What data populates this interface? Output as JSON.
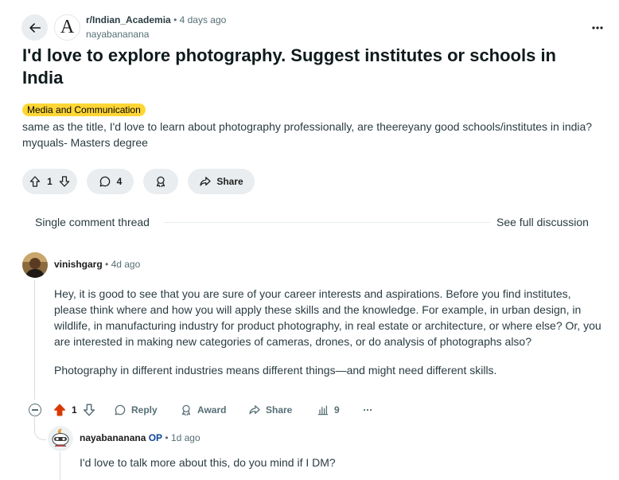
{
  "post": {
    "subreddit": "r/Indian_Academia",
    "subreddit_icon_letter": "A",
    "separator": "•",
    "time": "4 days ago",
    "author": "nayabananana",
    "title": "I'd love to explore photography. Suggest institutes or schools in India",
    "flair": "Media and Communication",
    "flair_color": "#ffd635",
    "body": "same as the title, I'd love to learn about photography professionally, are theereyany good schools/institutes in india? myquals- Masters degree",
    "votes": "1",
    "comments": "4",
    "share_label": "Share"
  },
  "thread": {
    "label": "Single comment thread",
    "full_link": "See full discussion"
  },
  "comment1": {
    "author": "vinishgarg",
    "separator": "•",
    "time": "4d ago",
    "paragraphs": [
      "Hey, it is good to see that you are sure of your career interests and aspirations. Before you find institutes, please think where and how you will apply these skills and the knowledge. For example, in urban design, in wildlife, in manufacturing industry for product photography, in real estate or architecture, or where else? Or, you are interested in making new categories of cameras, drones, or do analysis of photographs also?",
      "Photography in different industries means different things—and might need different skills."
    ],
    "votes": "1",
    "reply_label": "Reply",
    "award_label": "Award",
    "share_label": "Share",
    "insights": "9",
    "upvote_color": "#d93900"
  },
  "comment2": {
    "author": "nayabananana",
    "op_badge": "OP",
    "separator": "•",
    "time": "1d ago",
    "body": "I'd love to talk more about this, do you mind if I DM?"
  },
  "icons": {
    "back": "arrow-left-icon",
    "more": "more-horizontal-icon",
    "upvote": "upvote-arrow-icon",
    "downvote": "downvote-arrow-icon",
    "comment": "comment-bubble-icon",
    "award": "award-ribbon-icon",
    "share": "share-arrow-icon",
    "insights": "bar-chart-icon",
    "collapse": "collapse-minus-icon"
  }
}
